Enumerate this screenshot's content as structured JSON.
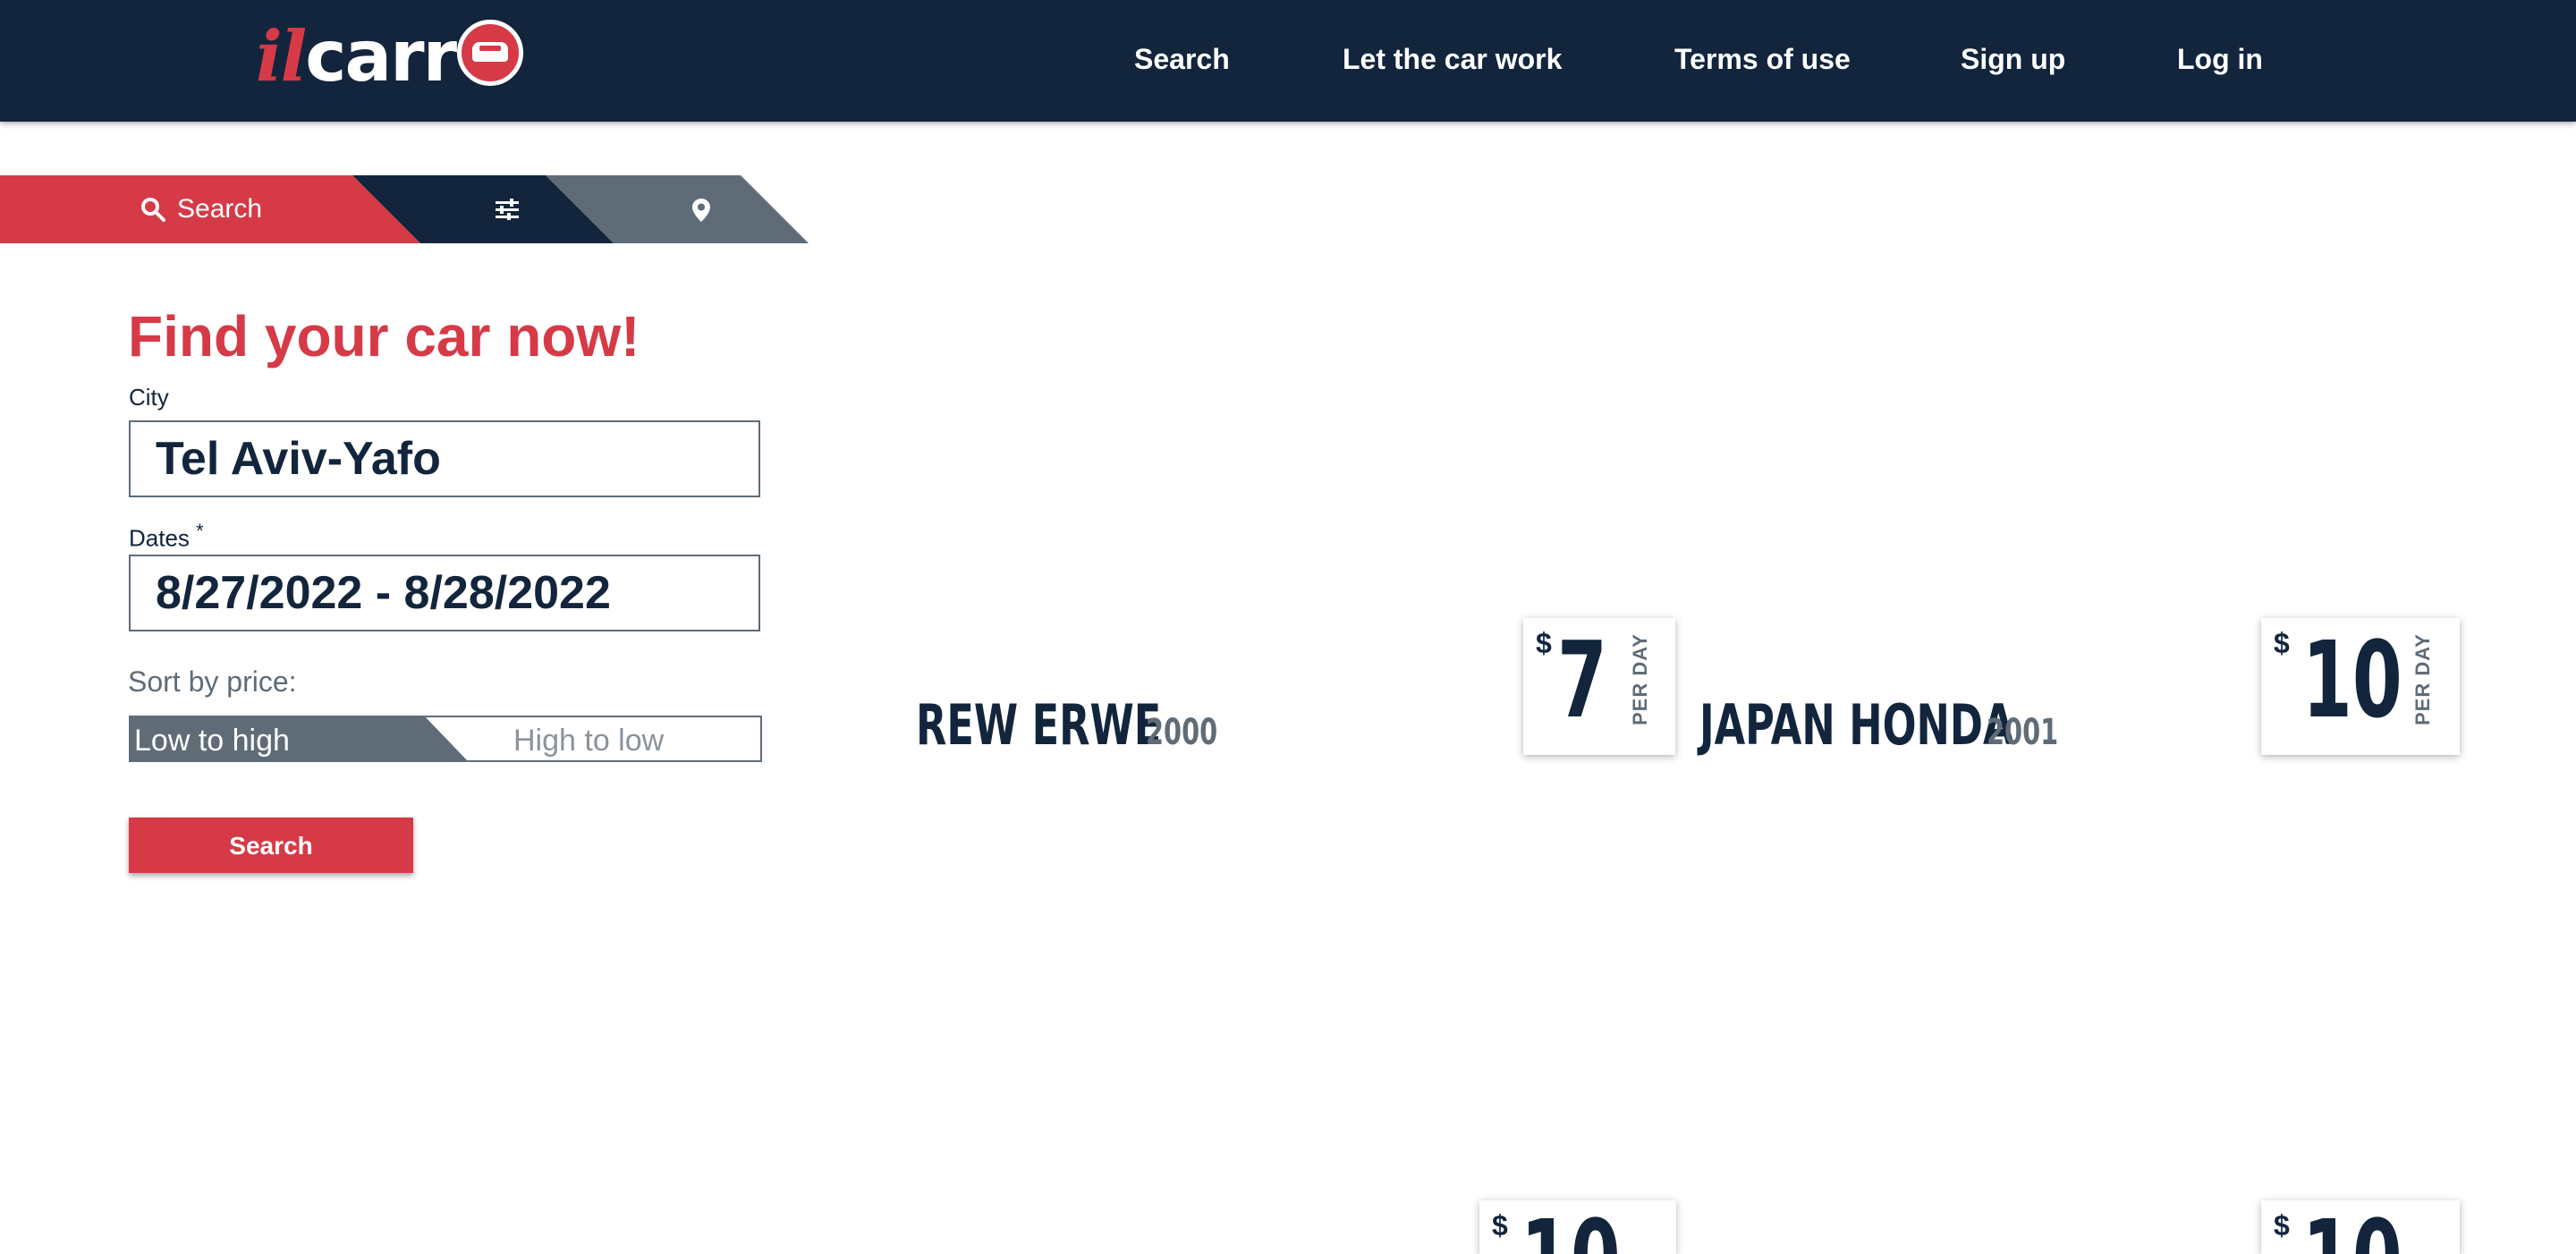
{
  "header": {
    "logo": {
      "part1": "il",
      "part2": "carr"
    },
    "nav": [
      "Search",
      "Let the car work",
      "Terms of use",
      "Sign up",
      "Log in"
    ]
  },
  "tabs": {
    "search_label": "Search",
    "icons": [
      "search-icon",
      "sliders-icon",
      "map-pin-icon"
    ]
  },
  "form": {
    "title": "Find your car now!",
    "city_label": "City",
    "city_value": "Tel Aviv-Yafo",
    "dates_label": "Dates",
    "dates_required": "*",
    "dates_value": "8/27/2022 - 8/28/2022",
    "sort_label": "Sort by price:",
    "sort_options": [
      "Low to high",
      "High to low"
    ],
    "sort_selected": "Low to high",
    "search_button": "Search"
  },
  "cars": [
    {
      "name": "REW ERWE",
      "year": "2000",
      "currency": "$",
      "price": "7",
      "per": "PER DAY"
    },
    {
      "name": "JAPAN HONDA",
      "year": "2001",
      "currency": "$",
      "price": "10",
      "per": "PER DAY"
    }
  ],
  "partial_prices": [
    {
      "currency": "$",
      "price": "10",
      "per": "Y"
    },
    {
      "currency": "$",
      "price": "10",
      "per": "Y"
    }
  ],
  "colors": {
    "brand_red": "#d63a47",
    "navy": "#12253c",
    "slate": "#5f6c78"
  }
}
